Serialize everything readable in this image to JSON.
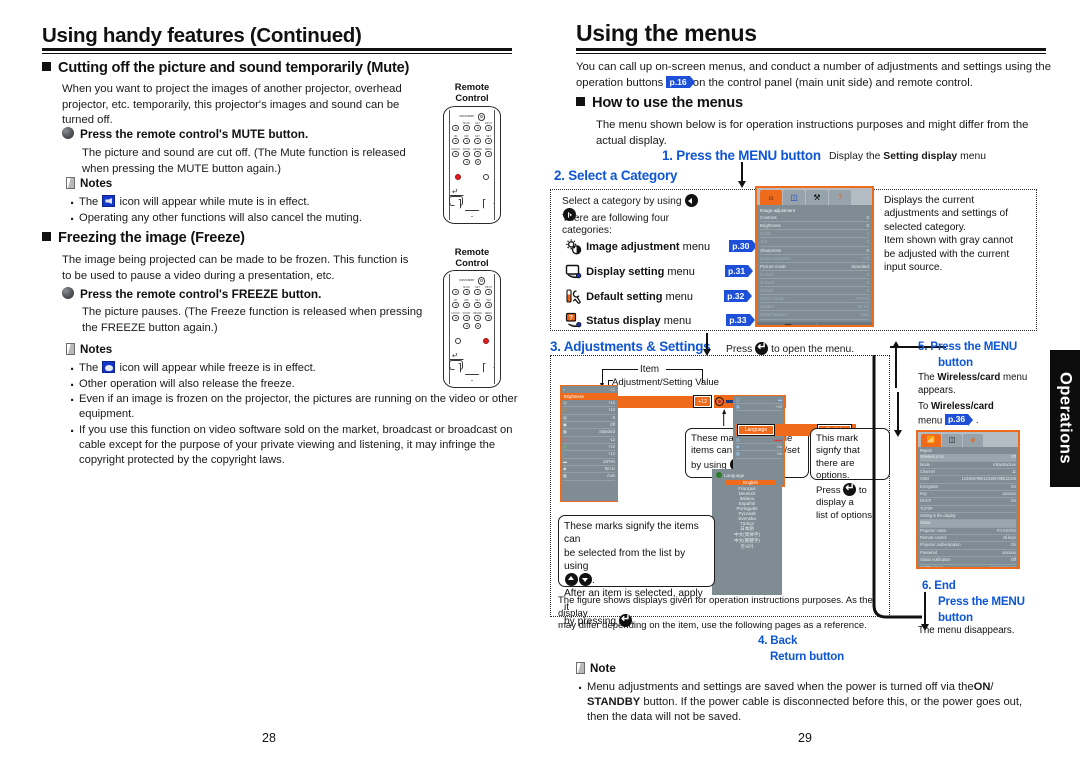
{
  "left_page": {
    "title": "Using handy features (Continued)",
    "folio": "28",
    "section_mute": {
      "heading": "Cutting off the picture and sound temporarily (Mute)",
      "intro": "When you want to project the images of another projector, overhead projector, etc. temporarily, this projector's images and sound can be turned off.",
      "step_heading": "Press the remote control's MUTE button.",
      "step_body": "The picture and sound are cut off. (The Mute function is released when pressing the MUTE button again.)",
      "notes_label": "Notes",
      "notes": [
        "The  icon will appear while mute is in effect.",
        "Operating any other functions will also cancel the muting."
      ],
      "note1_pre": "The",
      "note1_post": "icon will appear while mute is in effect.",
      "remote_label": "Remote\nControl",
      "remote_label_line1": "Remote",
      "remote_label_line2": "Control"
    },
    "section_freeze": {
      "heading": "Freezing the image (Freeze)",
      "intro": "The image being projected can be made to be frozen. This function is to be used to pause a video during a presentation, etc.",
      "step_heading": "Press the remote control's FREEZE button.",
      "step_body": "The picture pauses. (The Freeze function is released when pressing the FREEZE button again.)",
      "notes_label": "Notes",
      "note1_pre": "The",
      "note1_post": "icon will appear while freeze is in effect.",
      "notes_rest": [
        "Other operation will also release the freeze.",
        "Even if an image is frozen on the projector, the pictures are running on the video or other equipment.",
        "If you use this function on video software sold on the market, broadcast or broadcast on cable except for the purpose of your private viewing and listening, it may infringe the copyright protected by the copyright laws."
      ],
      "remote_label_line1": "Remote",
      "remote_label_line2": "Control"
    },
    "remote_keys": {
      "top_label": "ON/STANDBY",
      "labels": [
        "1",
        "2",
        "3",
        "4",
        "5",
        "6",
        "7",
        "8",
        "9",
        "0"
      ],
      "mute_label": "MUTE",
      "freeze_label": "FREEZE",
      "left_labels": [
        "VOL-",
        "RETURN"
      ],
      "right_labels": [
        "VOL+",
        "INPUT",
        "AUTO SET",
        "RESIZE",
        "MENU"
      ]
    }
  },
  "right_page": {
    "title": "Using the menus",
    "folio": "29",
    "intro_a": "You can call up on-screen menus, and conduct a number of adjustments and settings using the operation buttons",
    "intro_tag": "p.16",
    "intro_b": "on the control panel (main unit side) and remote control.",
    "how_heading": "How to use the menus",
    "how_body": "The menu shown below is for operation instructions purposes and might differ from the actual display.",
    "step1": {
      "label": "1. Press the MENU button",
      "note_pre": "Display the",
      "note_bold": "Setting display",
      "note_post": "menu"
    },
    "step2": {
      "label": "2. Select a Category",
      "line1_a": "Select a category by using",
      "line1_b": ".",
      "line2": "There are following four",
      "line3": "categories:",
      "categories": [
        {
          "name": "Image adjustment",
          "suffix": "menu",
          "page": "p.30",
          "icon": "brightness-contrast-icon"
        },
        {
          "name": "Display setting",
          "suffix": "menu",
          "page": "p.31",
          "icon": "screen-icon"
        },
        {
          "name": "Default setting",
          "suffix": "menu",
          "page": "p.32",
          "icon": "wrench-icon"
        },
        {
          "name": "Status display",
          "suffix": "menu",
          "page": "p.33",
          "icon": "info-screen-icon"
        }
      ],
      "right_text": "Displays the current adjustments and settings of selected category. Item shown with gray cannot be adjusted with the current input source.",
      "right_lines": [
        "Displays the current",
        "adjustments and settings of",
        "selected category.",
        "Item shown with gray cannot",
        "be adjusted with the current",
        "input source."
      ]
    },
    "step3": {
      "label": "3. Adjustments & Settings",
      "press_pre": "Press",
      "press_post": "to open the menu.",
      "anno_item": "Item",
      "anno_value": "Adjustment/Setting Value",
      "callout_marks_adjust": [
        "These marks signify the",
        "items can be adjusted/set",
        "by using"
      ],
      "callout_options": [
        "This mark signfy that",
        "there are options.",
        "Press",
        "to display a",
        "list of options."
      ],
      "callout_options_l1": "This mark signfy that",
      "callout_options_l2": "there are options.",
      "callout_options_l3a": "Press",
      "callout_options_l3b": "to display a",
      "callout_options_l4": "list of options.",
      "callout_list_l1": "These marks signify the items can",
      "callout_list_l2": "be selected from the list by using",
      "callout_list_l3": ".",
      "callout_list_l4": "After an item is selected, apply it",
      "callout_list_l5a": "by pressing",
      "callout_list_l5b": ".",
      "footer_l1": "The figure shows displays given for operation instructions purposes.  As the display",
      "footer_l2": "may differ depending on the item, use the following pages as a reference."
    },
    "step4": {
      "label_l1": "4. Back",
      "label_l2": "Return button"
    },
    "step5": {
      "label_l1": "5. Press the MENU",
      "label_l2": "button",
      "body_pre": "The",
      "body_bold": "Wireless/card",
      "body_post": "menu appears.",
      "to_pre": "To",
      "to_bold": "Wireless/card",
      "to_post": "menu",
      "to_tag": "p.36",
      "to_end": "."
    },
    "step6": {
      "label_l1": "6. End",
      "label_l2": "Press the MENU",
      "label_l3": "button",
      "body": "The menu disappears."
    },
    "note": {
      "label": "Note",
      "l1a": "Menu adjustments and settings are saved when the power is turned off via the",
      "l1b": "ON",
      "l1c": "/",
      "l2a": "STANDBY",
      "l2b": "button. If the power cable is disconnected before this, or the power goes out,",
      "l3": "then the data will not be saved."
    },
    "side_tab": "Operations"
  },
  "osd_image_adjustment": {
    "title": "Image adjustment",
    "tabs": [
      "image-adjustment-tab",
      "display-setting-tab",
      "default-setting-tab",
      "status-display-tab"
    ],
    "active_tab": 0,
    "rows": [
      {
        "label": "Contrast",
        "value": "0",
        "dim": false
      },
      {
        "label": "Brightness",
        "value": "0",
        "dim": false
      },
      {
        "label": "Color",
        "value": "0",
        "dim": true
      },
      {
        "label": "Tint",
        "value": "0",
        "dim": true
      },
      {
        "label": "Sharpness",
        "value": "0",
        "dim": false
      },
      {
        "label": "Noise reduction",
        "value": "Off",
        "dim": true
      },
      {
        "label": "Picture mode",
        "value": "Standard",
        "dim": false
      },
      {
        "label": "R-level",
        "value": "0",
        "dim": true
      },
      {
        "label": "G-level",
        "value": "0",
        "dim": true
      },
      {
        "label": "B-level",
        "value": "0",
        "dim": true
      },
      {
        "label": "NTSC mode",
        "value": "JAPAN",
        "dim": true
      },
      {
        "label": "Shutter",
        "value": "50 Hz",
        "dim": true
      },
      {
        "label": "White balance",
        "value": "Auto",
        "dim": true
      }
    ],
    "footer": "To Image adjustment menu"
  },
  "osd_adjust_demo": {
    "selected_label": "Brightness",
    "selected_value": "+12",
    "side_values": [
      "-12",
      "",
      "+12",
      "+12",
      "-5",
      "Off",
      "Standard",
      "-12",
      "+12",
      "+12",
      "JAPAN",
      "50 Hz",
      "Auto"
    ]
  },
  "osd_language_demo": {
    "selected_label": "Language",
    "selected_value": "English",
    "rows_right": [
      "+12",
      "",
      "",
      "On",
      "On"
    ]
  },
  "osd_language_list": {
    "title": "Language",
    "selected": "English",
    "items": [
      "English",
      "Français",
      "Deutsch",
      "Italiano",
      "Español",
      "Português",
      "Русский",
      "Svenska",
      "Türkçe",
      "日本語",
      "中文(简体字)",
      "中文(繁體字)",
      "한국어"
    ]
  },
  "osd_wireless": {
    "tabs": [
      "wireless-tab",
      "card-tab",
      "status-tab"
    ],
    "active_tab": 0,
    "group1_title": "Report",
    "group1_head": "Wireless LAN",
    "rows1": [
      {
        "label": "Mode",
        "value": "Infrastructure"
      },
      {
        "label": "Channel",
        "value": "11"
      },
      {
        "label": "SSID",
        "value": "1234567890123456789012345"
      },
      {
        "label": "Encryption",
        "value": "On"
      },
      {
        "label": "Key",
        "value": "xxxxxxx"
      },
      {
        "label": "DHCP",
        "value": "On"
      },
      {
        "label": "TCP/IP",
        "value": ""
      },
      {
        "label": "Setting in the display",
        "value": ""
      }
    ],
    "group2_head": "Status",
    "rows2": [
      {
        "label": "Projector name",
        "value": "PJ-XXXXX"
      },
      {
        "label": "Remote control",
        "value": "All keys"
      },
      {
        "label": "Projector authentication",
        "value": "On"
      },
      {
        "label": "Password",
        "value": "xxxxxxx"
      },
      {
        "label": "Status notification",
        "value": "Off"
      },
      {
        "label": "SMTP server",
        "value": "xxx.xxx.xxx.xxx"
      },
      {
        "label": "Destination address",
        "value": ""
      },
      {
        "label": "",
        "value": "xxxxxxxx.xxxxxxx@xxxx.xxx"
      },
      {
        "label": "",
        "value": "xxxxxxxx.xxxxxxxxxxx.co.jp"
      }
    ],
    "footer": "Wireless menu"
  },
  "colors": {
    "accent_blue": "#0d56d6",
    "tag_blue": "#1d4fd8",
    "osd_orange": "#ef6a1b",
    "osd_bg": "#7f8c94",
    "led_red": "#e21b1b",
    "icon_blue": "#1437c8"
  }
}
